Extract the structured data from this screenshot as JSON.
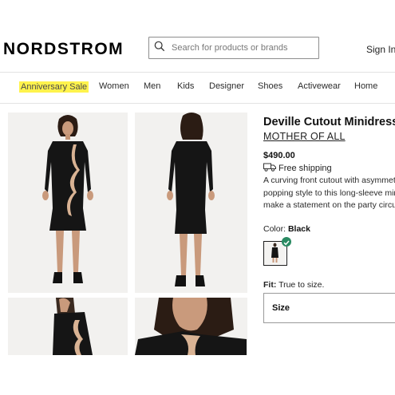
{
  "header": {
    "logo": "NORDSTROM",
    "search_placeholder": "Search for products or brands",
    "sign_in": "Sign In"
  },
  "nav": {
    "items": [
      "Anniversary Sale",
      "Women",
      "Men",
      "Kids",
      "Designer",
      "Shoes",
      "Activewear",
      "Home"
    ],
    "highlight_color": "#fff34d"
  },
  "product": {
    "title": "Deville Cutout Minidress",
    "brand": "MOTHER OF ALL",
    "price": "$490.00",
    "shipping": "Free shipping",
    "description_lines": [
      "A curving front cutout with asymmetric",
      "popping style to this long-sleeve minic",
      "make a statement on the party circuit."
    ],
    "color_label": "Color:",
    "color_value": "Black",
    "fit_label": "Fit:",
    "fit_value": "True to size.",
    "size_label": "Size"
  },
  "icons": {
    "search": "search-icon",
    "shipping": "truck-icon",
    "selected": "check-icon"
  },
  "colors": {
    "check_green": "#2a8a62",
    "dress": "#151515"
  }
}
